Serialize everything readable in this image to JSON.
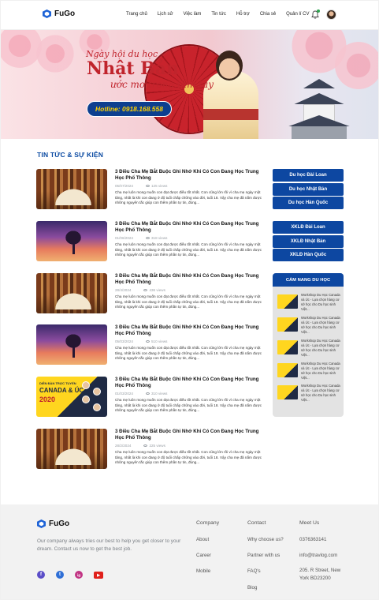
{
  "header": {
    "logo_text": "FuGo",
    "nav": [
      "Trang chủ",
      "Lịch sử",
      "Việc làm",
      "Tin tức",
      "Hỗ trợ",
      "Chia sẻ",
      "Quản lí CV"
    ]
  },
  "banner": {
    "line1": "Ngày hội du học",
    "line2": "Nhật Bản",
    "line3": "ước mơ trong tầm tay",
    "hotline": "Hotline: 0918.168.558"
  },
  "section": {
    "title": "TIN TỨC & SỰ KIỆN"
  },
  "news": [
    {
      "thumb": "books",
      "title": "3 Điều Cha Mẹ Bắt Buộc Ghi Nhớ Khi Có Con Đang Học Trung Học Phổ Thông",
      "date": "05/07/2024",
      "views": "125 views",
      "desc": "Cha mẹ luôn mong muốn con đạt được điều tốt nhất. Con cũng lớn rồi vì cha mẹ ngày một tăng, nhất là khi con đang ở độ tuổi chấp chững vào đời, tuổi 18. Vậy cha mẹ đã nắm được những nguyên tắc giúp con thêm phần tự tin, đúng..."
    },
    {
      "thumb": "tree",
      "title": "3 Điều Cha Mẹ Bắt Buộc Ghi Nhớ Khi Có Con Đang Học Trung Học Phổ Thông",
      "date": "01/06/2024",
      "views": "318 views",
      "desc": "Cha mẹ luôn mong muốn con đạt được điều tốt nhất. Con cũng lớn rồi vì cha mẹ ngày một tăng, nhất là khi con đang ở độ tuổi chấp chững vào đời, tuổi 18. Vậy cha mẹ đã nắm được những nguyên tắc giúp con thêm phần tự tin, đúng..."
    },
    {
      "thumb": "books",
      "title": "3 Điều Cha Mẹ Bắt Buộc Ghi Nhớ Khi Có Con Đang Học Trung Học Phổ Thông",
      "date": "28/4/2024",
      "views": "436 views",
      "desc": "Cha mẹ luôn mong muốn con đạt được điều tốt nhất. Con cũng lớn rồi vì cha mẹ ngày một tăng, nhất là khi con đang ở độ tuổi chấp chững vào đời, tuổi 18. Vậy cha mẹ đã nắm được những nguyên tắc giúp con thêm phần tự tin, đúng..."
    },
    {
      "thumb": "tree",
      "title": "3 Điều Cha Mẹ Bắt Buộc Ghi Nhớ Khi Có Con Đang Học Trung Học Phổ Thông",
      "date": "05/03/2024",
      "views": "510 views",
      "desc": "Cha mẹ luôn mong muốn con đạt được điều tốt nhất. Con cũng lớn rồi vì cha mẹ ngày một tăng, nhất là khi con đang ở độ tuổi chấp chững vào đời, tuổi 18. Vậy cha mẹ đã nắm được những nguyên tắc giúp con thêm phần tự tin, đúng..."
    },
    {
      "thumb": "canada",
      "title": "3 Điều Cha Mẹ Bắt Buộc Ghi Nhớ Khi Có Con Đang Học Trung Học Phổ Thông",
      "date": "01/03/2024",
      "views": "310 views",
      "desc": "Cha mẹ luôn mong muốn con đạt được điều tốt nhất. Con cũng lớn rồi vì cha mẹ ngày một tăng, nhất là khi con đang ở độ tuổi chấp chững vào đời, tuổi 18. Vậy cha mẹ đã nắm được những nguyên tắc giúp con thêm phần tự tin, đúng...",
      "canada_text": {
        "t1": "DIỄN ĐÀN TRỰC TUYẾN",
        "t2": "CANADA & ÚC",
        "t3": "2020"
      }
    },
    {
      "thumb": "books",
      "title": "3 Điều Cha Mẹ Bắt Buộc Ghi Nhớ Khi Có Con Đang Học Trung Học Phổ Thông",
      "date": "28/2/2024",
      "views": "225 views",
      "desc": "Cha mẹ luôn mong muốn con đạt được điều tốt nhất. Con cũng lớn rồi vì cha mẹ ngày một tăng, nhất là khi con đang ở độ tuổi chấp chững vào đời, tuổi 18. Vậy cha mẹ đã nắm được những nguyên tắc giúp con thêm phần tự tin, đúng..."
    }
  ],
  "sidebar": {
    "study": [
      "Du học Đài Loan",
      "Du học Nhật Bản",
      "Du học Hàn Quốc"
    ],
    "labor": [
      "XKLĐ Đài Loan",
      "XKLĐ Nhật Bản",
      "XKLĐ Hàn Quốc"
    ],
    "handbook_title": "CẨM NANG DU HỌC",
    "handbook_items": [
      "Workshop Du Học Canada và Úc - Lựa chọn hàng cơ sở học cho Du học sinh Việt...",
      "Workshop Du Học Canada và Úc - Lựa chọn hàng cơ sở học cho Du học sinh Việt...",
      "Workshop Du Học Canada và Úc - Lựa chọn hàng cơ sở học cho Du học sinh Việt...",
      "Workshop Du Học Canada và Úc - Lựa chọn hàng cơ sở học cho Du học sinh Việt...",
      "Workshop Du Học Canada và Úc - Lựa chọn hàng cơ sở học cho Du học sinh Việt..."
    ]
  },
  "footer": {
    "logo_text": "FuGo",
    "desc": "Our company always tries our best to help you get closer to your dream. Contact us now to get the best job.",
    "social": [
      "f",
      "t",
      "ig",
      "▶"
    ],
    "colors": {
      "facebook": "#5b4ec8",
      "twitter": "#2f6fd6",
      "instagram": "#c13584",
      "youtube": "#e0201b"
    },
    "company_title": "Company",
    "company_links": [
      "About",
      "Career",
      "Mobile"
    ],
    "contact_title": "Contact",
    "contact_links": [
      "Why choose us?",
      "Partner with us",
      "FAQ's",
      "Blog"
    ],
    "meet_title": "Meet Us",
    "phone": "0376363141",
    "email": "info@travlog.com",
    "address": "205. R Street, New York BD23200"
  },
  "colors": {
    "primary": "#0d47a1",
    "accent_red": "#c0242c",
    "hotline_yellow": "#ffd200"
  }
}
